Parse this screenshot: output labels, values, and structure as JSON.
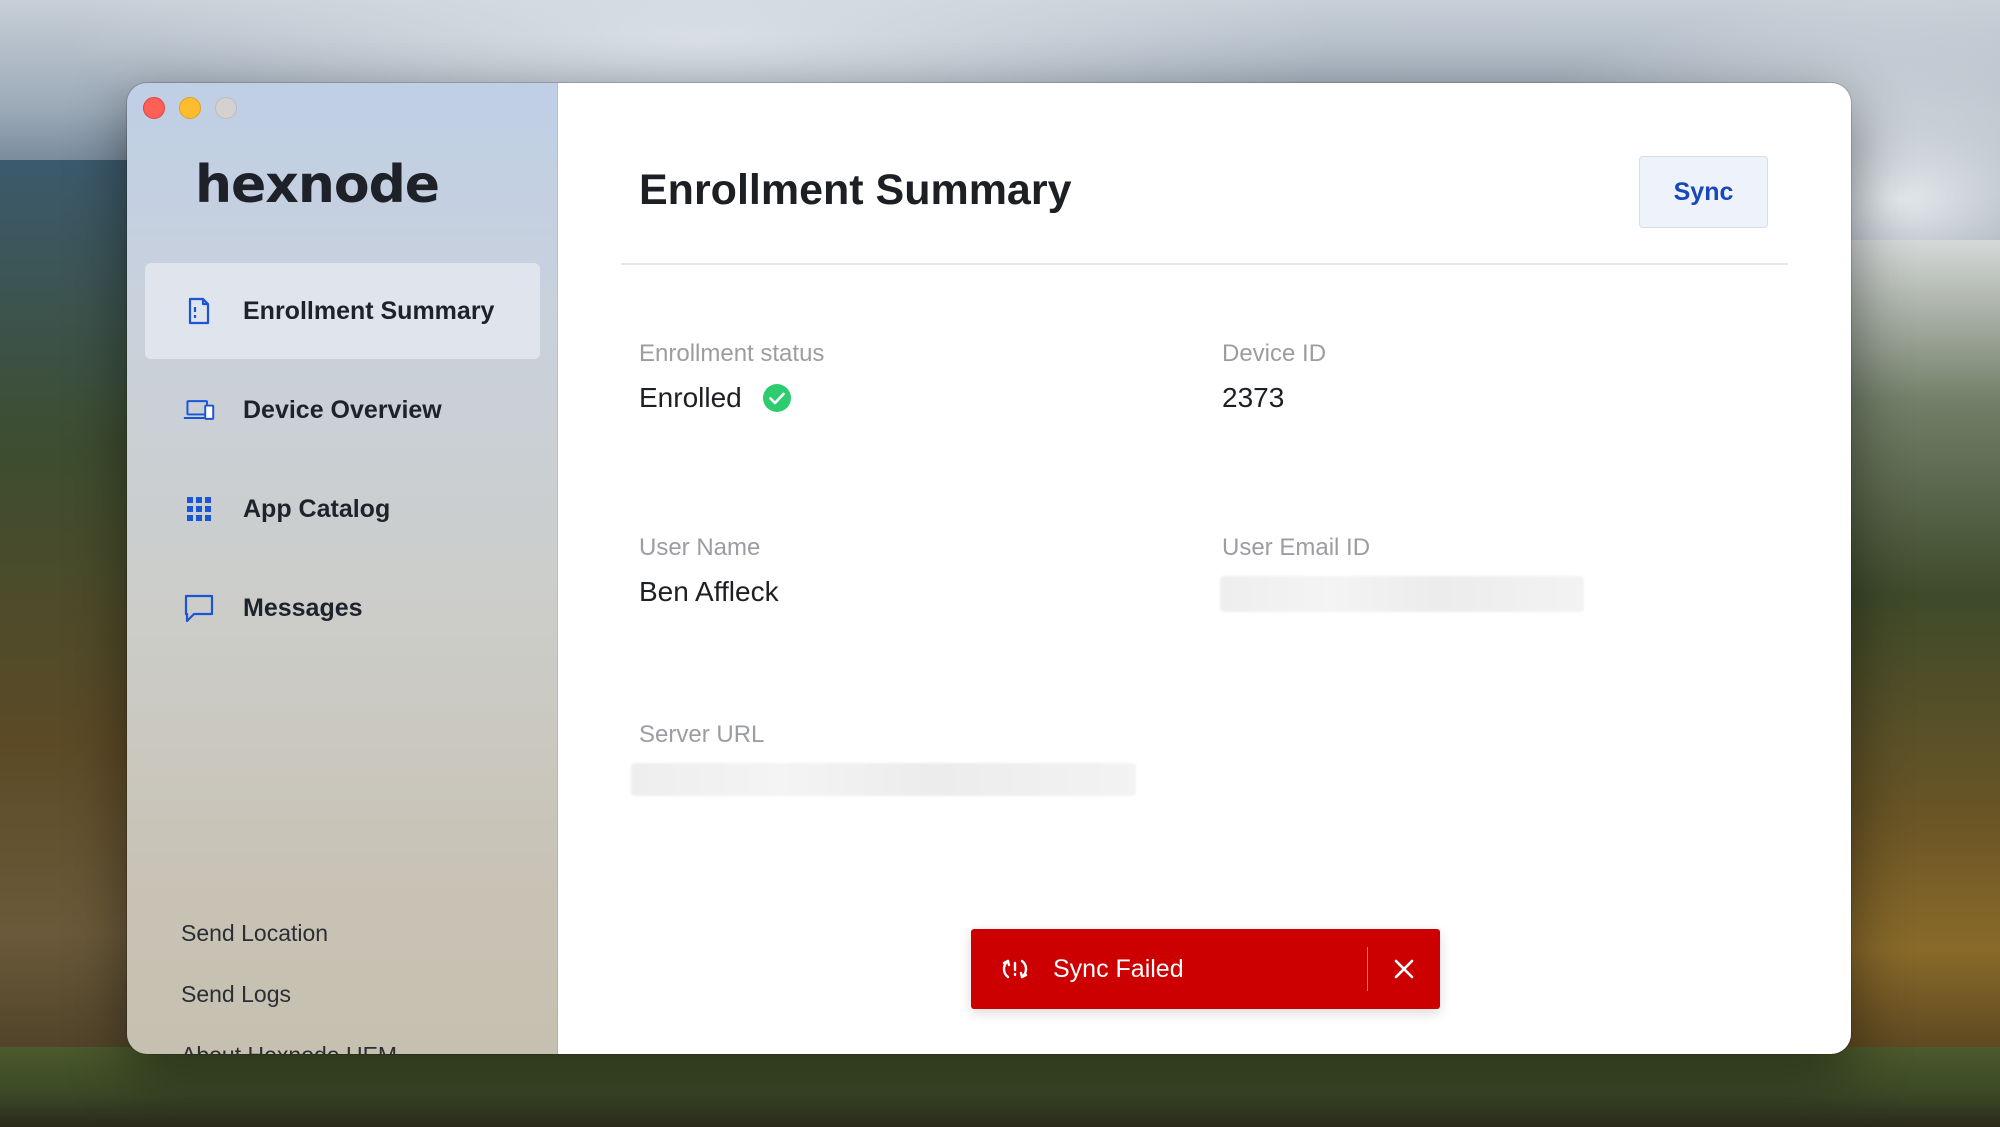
{
  "app": {
    "logo_text": "hexnode"
  },
  "sidebar": {
    "items": [
      {
        "label": "Enrollment Summary",
        "icon": "document-icon",
        "active": true
      },
      {
        "label": "Device Overview",
        "icon": "devices-icon",
        "active": false
      },
      {
        "label": "App Catalog",
        "icon": "grid-icon",
        "active": false
      },
      {
        "label": "Messages",
        "icon": "message-icon",
        "active": false
      }
    ],
    "footer": [
      {
        "label": "Send Location"
      },
      {
        "label": "Send Logs"
      },
      {
        "label": "About Hexnode UEM"
      }
    ]
  },
  "main": {
    "title": "Enrollment Summary",
    "sync_label": "Sync",
    "fields": {
      "enrollment_status": {
        "label": "Enrollment status",
        "value": "Enrolled"
      },
      "device_id": {
        "label": "Device ID",
        "value": "2373"
      },
      "user_name": {
        "label": "User Name",
        "value": "Ben Affleck"
      },
      "user_email": {
        "label": "User Email ID"
      },
      "server_url": {
        "label": "Server URL"
      }
    }
  },
  "toast": {
    "message": "Sync Failed",
    "icon": "sync-error-icon"
  },
  "colors": {
    "accent": "#1747b8",
    "error": "#cc0000",
    "success": "#2ecc71",
    "icon_blue": "#1a55d6"
  }
}
